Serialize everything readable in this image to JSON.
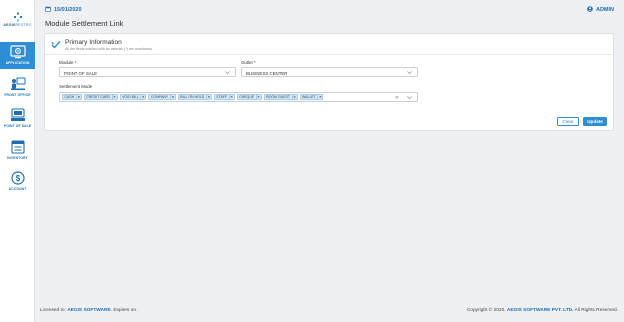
{
  "app": {
    "brand": "AEGISRESTRO",
    "brand_bold": "AEGIS",
    "brand_light": "RESTRO"
  },
  "topbar": {
    "date": "15/01/2020",
    "user": "ADMIN"
  },
  "sidebar": {
    "items": [
      {
        "label": "APPLICATION",
        "icon": "application-icon",
        "active": true
      },
      {
        "label": "FRONT OFFICE",
        "icon": "front-office-icon",
        "active": false
      },
      {
        "label": "POINT OF SALE",
        "icon": "point-of-sale-icon",
        "active": false
      },
      {
        "label": "INVENTORY",
        "icon": "inventory-icon",
        "active": false
      },
      {
        "label": "ACCOUNT",
        "icon": "account-icon",
        "active": false
      }
    ]
  },
  "page": {
    "title": "Module Settlement Link"
  },
  "form": {
    "section_title": "Primary Information",
    "section_subtitle": "All the fields marked with an asterisk (*) are mandatory.",
    "module": {
      "label": "Module *",
      "value": "POINT OF SALE"
    },
    "outlet": {
      "label": "Outlet *",
      "value": "BUSINESS CENTER"
    },
    "settlement_mode": {
      "label": "Settlement Mode",
      "tags": [
        "CASH",
        "CREDIT CARD",
        "VOID BILL",
        "COMPANY",
        "BILL ON HOLD",
        "STAFF",
        "CHEQUE",
        "ROOM GUEST",
        "WALLET"
      ],
      "clear_symbol": "✕"
    },
    "buttons": {
      "clear": "Clear",
      "update": "Update"
    }
  },
  "footer": {
    "left_prefix": "Licensed to: ",
    "left_brand": "AEGIS SOFTWARE",
    "left_suffix": ". Expires on .",
    "right_prefix": "Copyright © 2020. ",
    "right_brand": "AEGIS SOFTWARE PVT. LTD.",
    "right_suffix": " All Rights Reserved."
  },
  "colors": {
    "accent": "#2d8ed6",
    "brand_text": "#1f6fb0",
    "tag_bg": "#d6e9f8",
    "page_bg": "#eef0f3"
  }
}
